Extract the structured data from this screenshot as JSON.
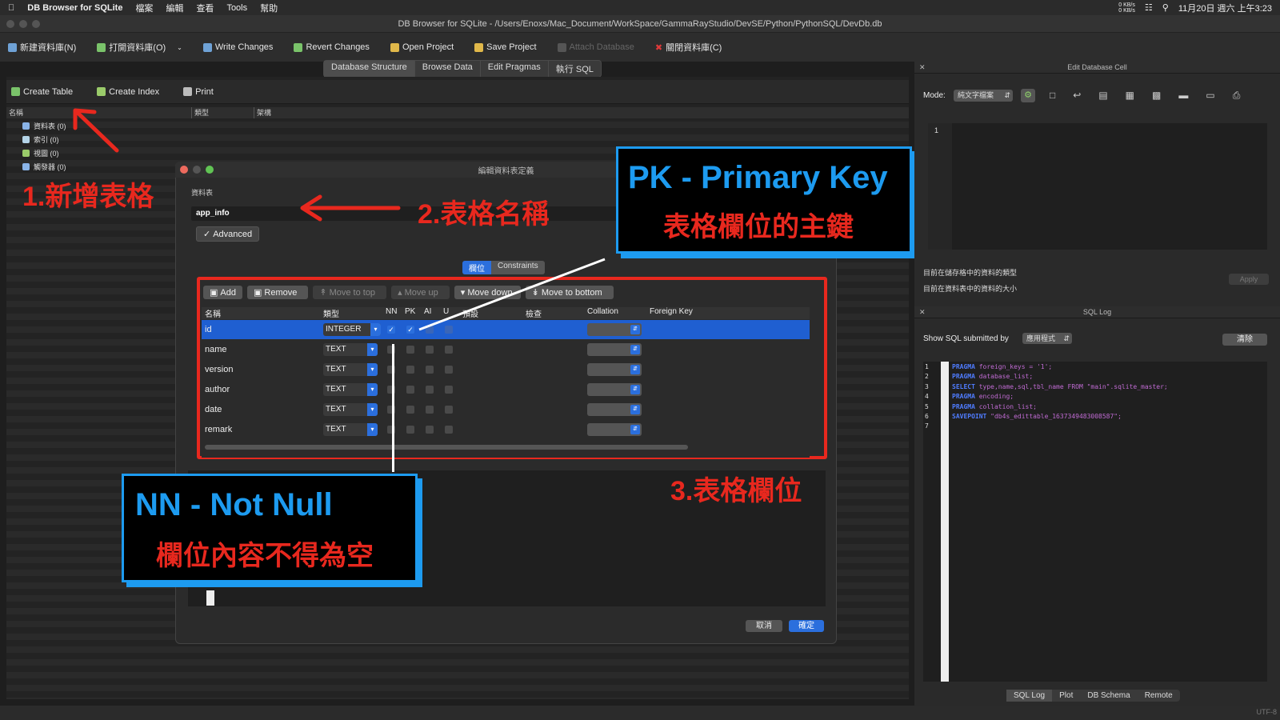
{
  "menubar": {
    "app_name": "DB Browser for SQLite",
    "items": [
      "檔案",
      "編輯",
      "查看",
      "Tools",
      "幫助"
    ],
    "net_up": "0 KB/s",
    "net_down": "0 KB/s",
    "clock": "11月20日 週六 上午3:23"
  },
  "window_title": "DB Browser for SQLite - /Users/Enoxs/Mac_Document/WorkSpace/GammaRayStudio/DevSE/Python/PythonSQL/DevDb.db",
  "toolbar": {
    "new_db": "新建資料庫(N)",
    "open_db": "打開資料庫(O)",
    "write_changes": "Write Changes",
    "revert_changes": "Revert Changes",
    "open_project": "Open Project",
    "save_project": "Save Project",
    "attach_db": "Attach Database",
    "close_db": "關閉資料庫(C)"
  },
  "main_tabs": [
    "Database Structure",
    "Browse Data",
    "Edit Pragmas",
    "執行 SQL"
  ],
  "structure": {
    "create_table": "Create Table",
    "create_index": "Create Index",
    "print": "Print",
    "col_name": "名稱",
    "col_type": "類型",
    "col_schema": "架構",
    "tree": [
      "資料表 (0)",
      "索引 (0)",
      "視圖 (0)",
      "觸發器 (0)"
    ]
  },
  "annotations": {
    "step1": "1.新增表格",
    "step2": "2.表格名稱",
    "step3": "3.表格欄位",
    "pk_title": "PK - Primary Key",
    "pk_desc": "表格欄位的主鍵",
    "nn_title": "NN - Not Null",
    "nn_desc": "欄位內容不得為空"
  },
  "dialog": {
    "title": "編輯資料表定義",
    "table_label": "資料表",
    "table_name": "app_info",
    "advanced": "Advanced",
    "tab_fields": "欄位",
    "tab_constraints": "Constraints",
    "add": "Add",
    "remove": "Remove",
    "move_top": "Move to top",
    "move_up": "Move up",
    "move_down": "Move down",
    "move_bottom": "Move to bottom",
    "headers": {
      "name": "名稱",
      "type": "類型",
      "nn": "NN",
      "pk": "PK",
      "ai": "AI",
      "u": "U",
      "default": "預設",
      "check": "檢查",
      "collation": "Collation",
      "fk": "Foreign Key"
    },
    "fields": [
      {
        "name": "id",
        "type": "INTEGER"
      },
      {
        "name": "name",
        "type": "TEXT"
      },
      {
        "name": "version",
        "type": "TEXT"
      },
      {
        "name": "author",
        "type": "TEXT"
      },
      {
        "name": "date",
        "type": "TEXT"
      },
      {
        "name": "remark",
        "type": "TEXT"
      }
    ],
    "cancel": "取消",
    "ok": "確定"
  },
  "edit_cell": {
    "title": "Edit Database Cell",
    "mode_label": "Mode:",
    "mode_value": "純文字檔案",
    "line1": "1",
    "type_text": "目前在儲存格中的資料的類型",
    "size_text": "目前在資料表中的資料的大小",
    "apply": "Apply"
  },
  "sql_log": {
    "title": "SQL Log",
    "show_label": "Show SQL submitted by",
    "source": "應用程式",
    "clear": "清除",
    "lines": [
      {
        "n": "1",
        "kw": "PRAGMA",
        "rest": " foreign_keys = '1';"
      },
      {
        "n": "2",
        "kw": "PRAGMA",
        "rest": " database_list;"
      },
      {
        "n": "3",
        "kw": "SELECT",
        "rest": " type,name,sql,tbl_name FROM \"main\".sqlite_master;"
      },
      {
        "n": "4",
        "kw": "PRAGMA",
        "rest": " encoding;"
      },
      {
        "n": "5",
        "kw": "PRAGMA",
        "rest": " collation_list;"
      },
      {
        "n": "6",
        "kw": "SAVEPOINT",
        "rest": " \"db4s_edittable_1637349483008587\";"
      },
      {
        "n": "7",
        "kw": "",
        "rest": ""
      }
    ]
  },
  "bottom_tabs": [
    "SQL Log",
    "Plot",
    "DB Schema",
    "Remote"
  ],
  "status": {
    "encoding": "UTF-8"
  }
}
